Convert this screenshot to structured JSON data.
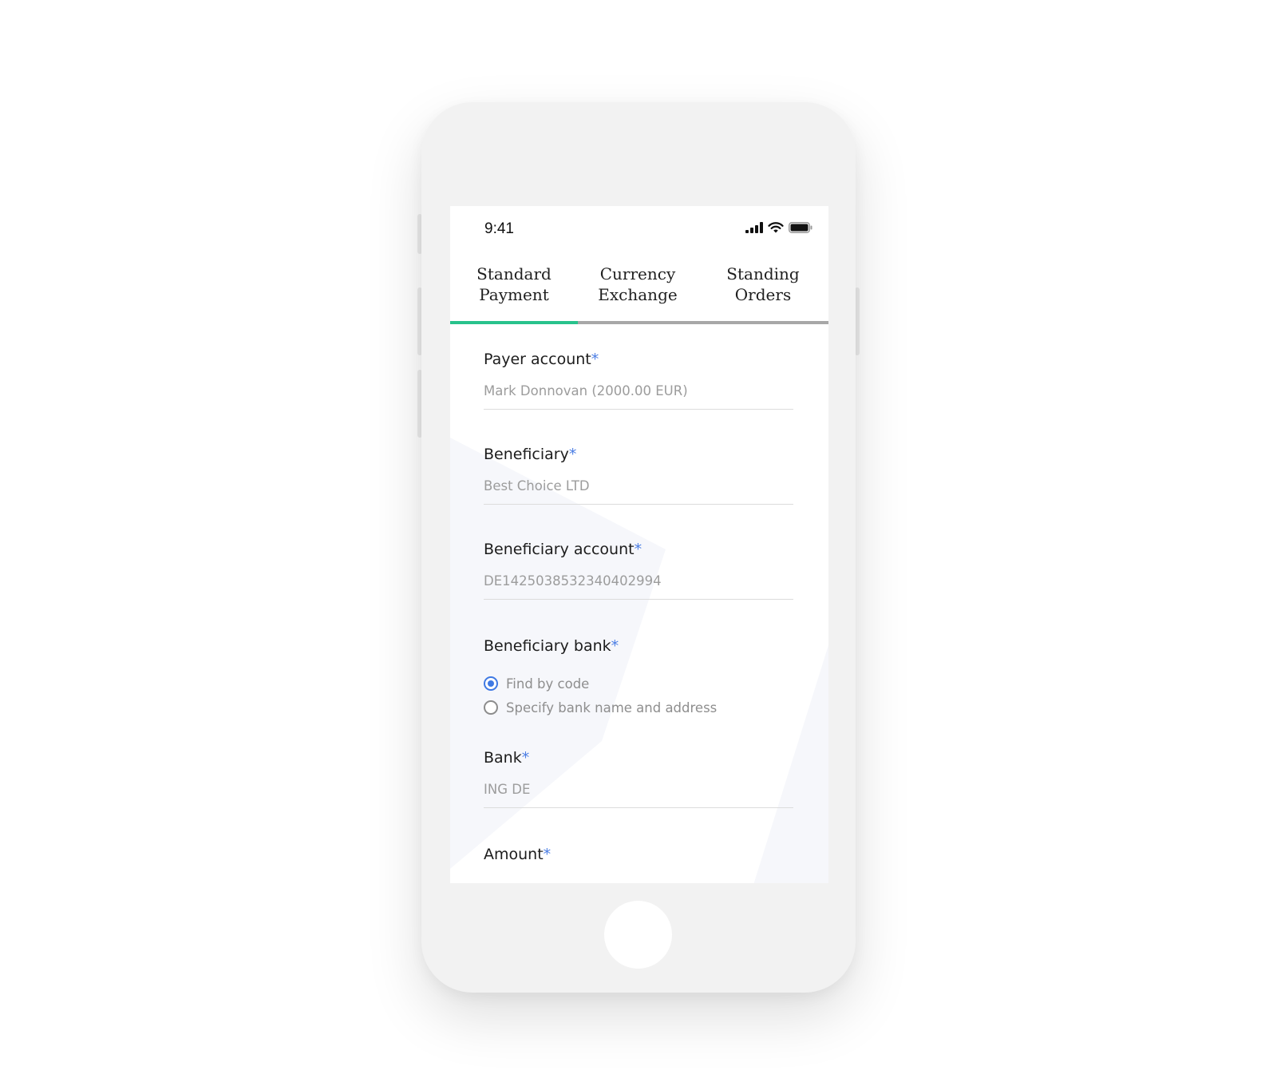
{
  "status_bar": {
    "time": "9:41"
  },
  "tabs": [
    {
      "line1": "Standard",
      "line2": "Payment",
      "active": true
    },
    {
      "line1": "Currency",
      "line2": "Exchange",
      "active": false
    },
    {
      "line1": "Standing",
      "line2": "Orders",
      "active": false
    }
  ],
  "form": {
    "required_mark": "*",
    "payer_account": {
      "label": "Payer account",
      "value": "Mark Donnovan (2000.00 EUR)"
    },
    "beneficiary": {
      "label": "Beneficiary",
      "value": "Best Choice LTD"
    },
    "beneficiary_account": {
      "label": "Beneficiary account",
      "value": "DE1425038532340402994"
    },
    "beneficiary_bank": {
      "label": "Beneficiary bank",
      "options": [
        {
          "label": "Find by code",
          "selected": true
        },
        {
          "label": "Specify bank name and address",
          "selected": false
        }
      ]
    },
    "bank": {
      "label": "Bank",
      "value": "ING DE"
    },
    "amount": {
      "label": "Amount"
    }
  },
  "colors": {
    "tab_active_indicator": "#28c28c",
    "required_asterisk": "#4a7de4",
    "radio_selected": "#3f79e3"
  },
  "icons": [
    "signal-icon",
    "wifi-icon",
    "battery-icon"
  ]
}
